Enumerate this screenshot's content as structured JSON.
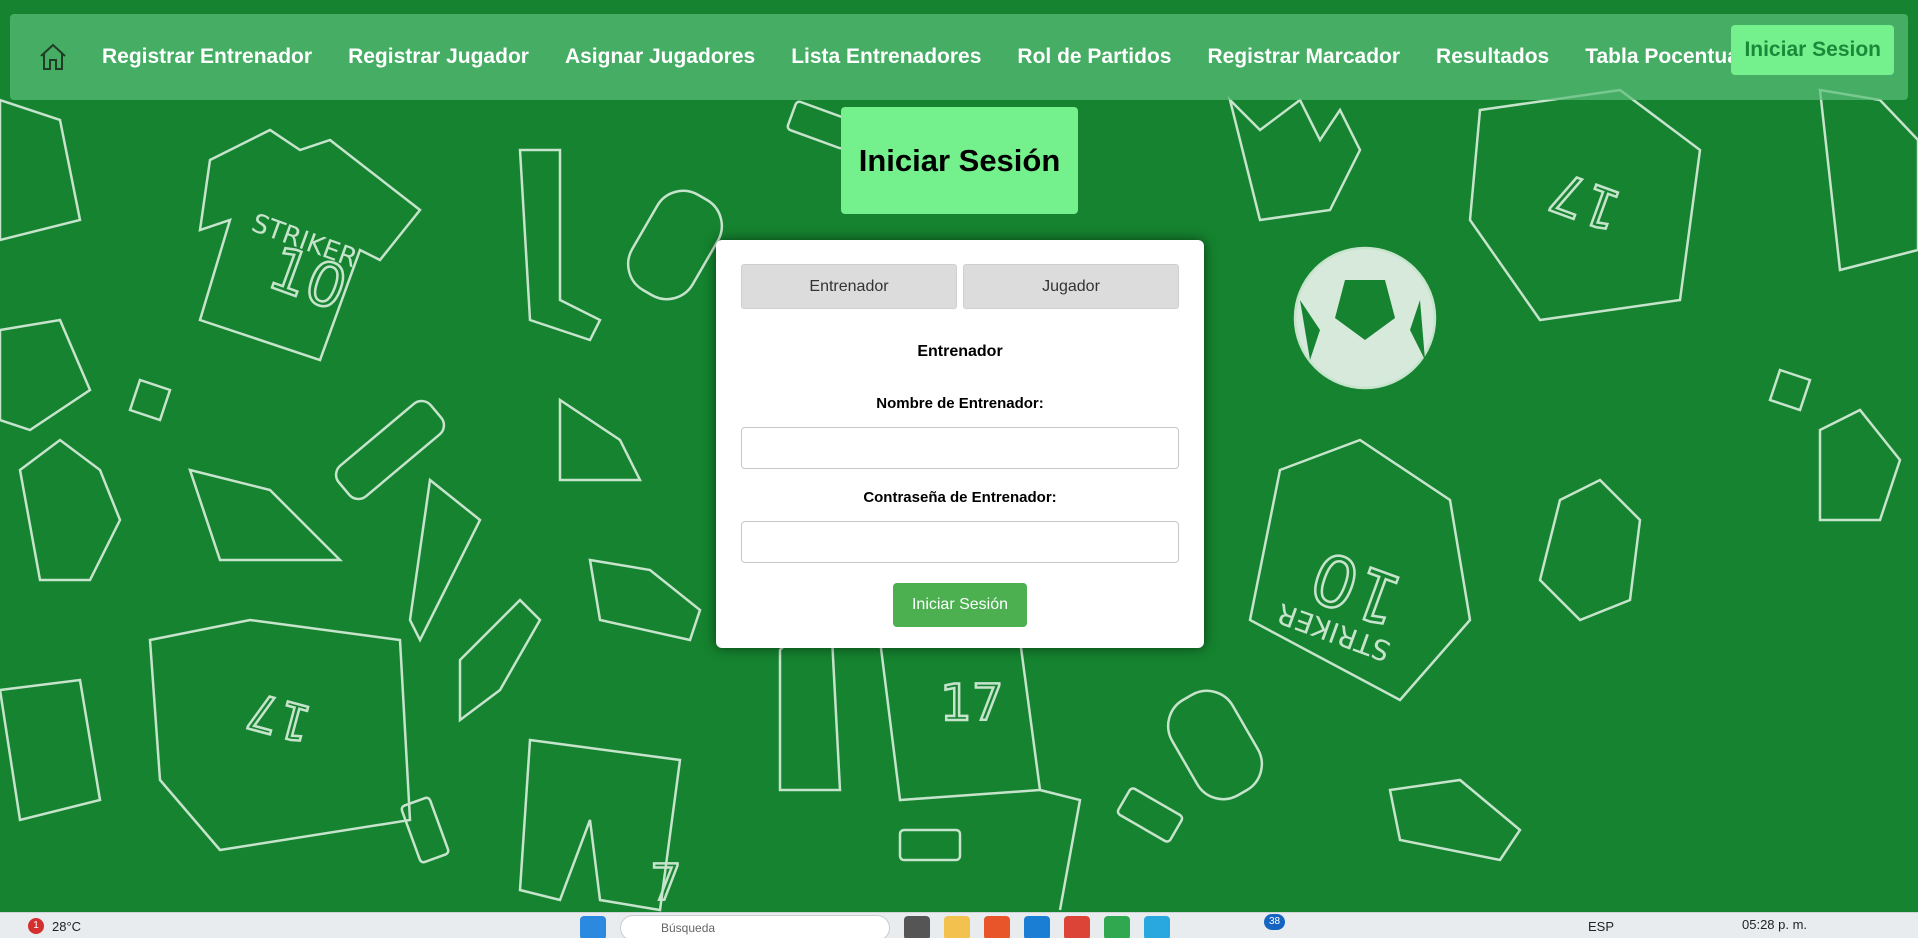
{
  "nav": {
    "items": [
      {
        "label": "Registrar Entrenador"
      },
      {
        "label": "Registrar Jugador"
      },
      {
        "label": "Asignar Jugadores"
      },
      {
        "label": "Lista Entrenadores"
      },
      {
        "label": "Rol de Partidos"
      },
      {
        "label": "Registrar Marcador"
      },
      {
        "label": "Resultados"
      },
      {
        "label": "Tabla Pocentual"
      }
    ],
    "login_label": "Iniciar Sesion"
  },
  "page": {
    "title": "Iniciar Sesión"
  },
  "form": {
    "tabs": [
      {
        "label": "Entrenador"
      },
      {
        "label": "Jugador"
      }
    ],
    "section_title": "Entrenador",
    "name_label": "Nombre de Entrenador:",
    "name_value": "",
    "password_label": "Contraseña de Entrenador:",
    "password_value": "",
    "submit_label": "Iniciar Sesión"
  },
  "taskbar": {
    "weather_badge": "1",
    "temperature": "28°C",
    "search_placeholder": "Búsqueda",
    "notification_count": "38",
    "language": "ESP",
    "time": "05:28 p. m."
  },
  "colors": {
    "background": "#15832f",
    "nav_bar": "#5abe78",
    "accent_green": "#74f08c",
    "submit_green": "#4caf50",
    "card": "#ffffff"
  }
}
